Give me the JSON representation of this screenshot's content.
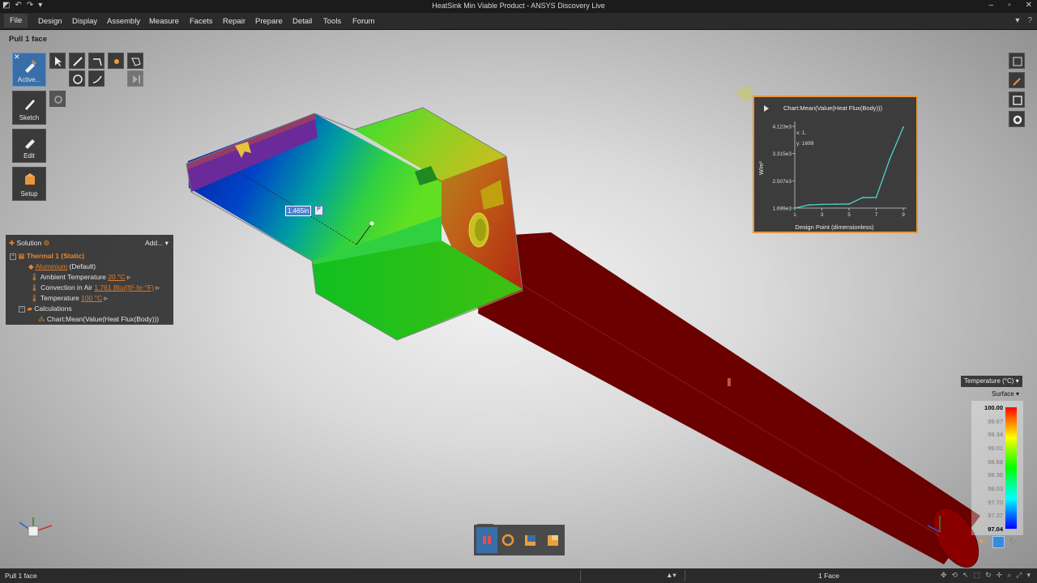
{
  "window": {
    "title": "HeatSink Min Viable Product - ANSYS Discovery Live"
  },
  "menu": {
    "items": [
      "File",
      "Design",
      "Display",
      "Assembly",
      "Measure",
      "Facets",
      "Repair",
      "Prepare",
      "Detail",
      "Tools",
      "Forum"
    ]
  },
  "tool_hint": "Pull 1 face",
  "tools": {
    "active_label": "Active...",
    "sketch_label": "Sketch",
    "edit_label": "Edit",
    "setup_label": "Setup"
  },
  "dimension": {
    "value": "1.465in",
    "pin": "P"
  },
  "tree": {
    "header_label": "Solution",
    "add_label": "Add...",
    "study": "Thermal 1 (Static)",
    "material_link": "Aluminium",
    "material_suffix": "(Default)",
    "ambient_label": "Ambient Temperature",
    "ambient_value": "20 °C",
    "convection_label": "Convection in Air",
    "convection_value": "1.761 Btu/(ft²·hr·°F)",
    "temperature_label": "Temperature",
    "temperature_value": "100 °C",
    "calculations_label": "Calculations",
    "chart_item": "Chart:Mean(Value(Heat Flux(Body)))"
  },
  "chart_data": {
    "type": "line",
    "title": "Chart:Mean(Value(Heat Flux(Body)))",
    "xlabel": "Design Point (dimensionless)",
    "ylabel": "W/m²",
    "x_ticks": [
      "1",
      "3",
      "5",
      "7",
      "9"
    ],
    "y_ticks": [
      "1.699e3",
      "2.507e3",
      "3.315e3",
      "4.123e3"
    ],
    "xlim": [
      1,
      9
    ],
    "ylim": [
      1699,
      4123
    ],
    "series": [
      {
        "x": [
          1,
          2,
          3,
          4,
          5,
          6,
          7,
          8,
          9
        ],
        "values": [
          1699,
          1790,
          1810,
          1815,
          1820,
          2010,
          2015,
          3150,
          4100
        ]
      }
    ],
    "tooltip": {
      "x_text": "x: 1.",
      "y_text": "y: 1699"
    },
    "line_color": "#4fd1c5"
  },
  "legend": {
    "quantity": "Temperature (°C)",
    "mode": "Surface",
    "values": [
      "100.00",
      "99.67",
      "99.34",
      "99.01",
      "98.68",
      "98.36",
      "98.03",
      "97.70",
      "97.37",
      "97.04"
    ]
  },
  "status": {
    "left": "Pull 1 face",
    "selection": "1 Face"
  },
  "colors": {
    "accent_blue": "#3a6ea8",
    "chart_border": "#e8963a",
    "tree_highlight": "#e8882e"
  }
}
